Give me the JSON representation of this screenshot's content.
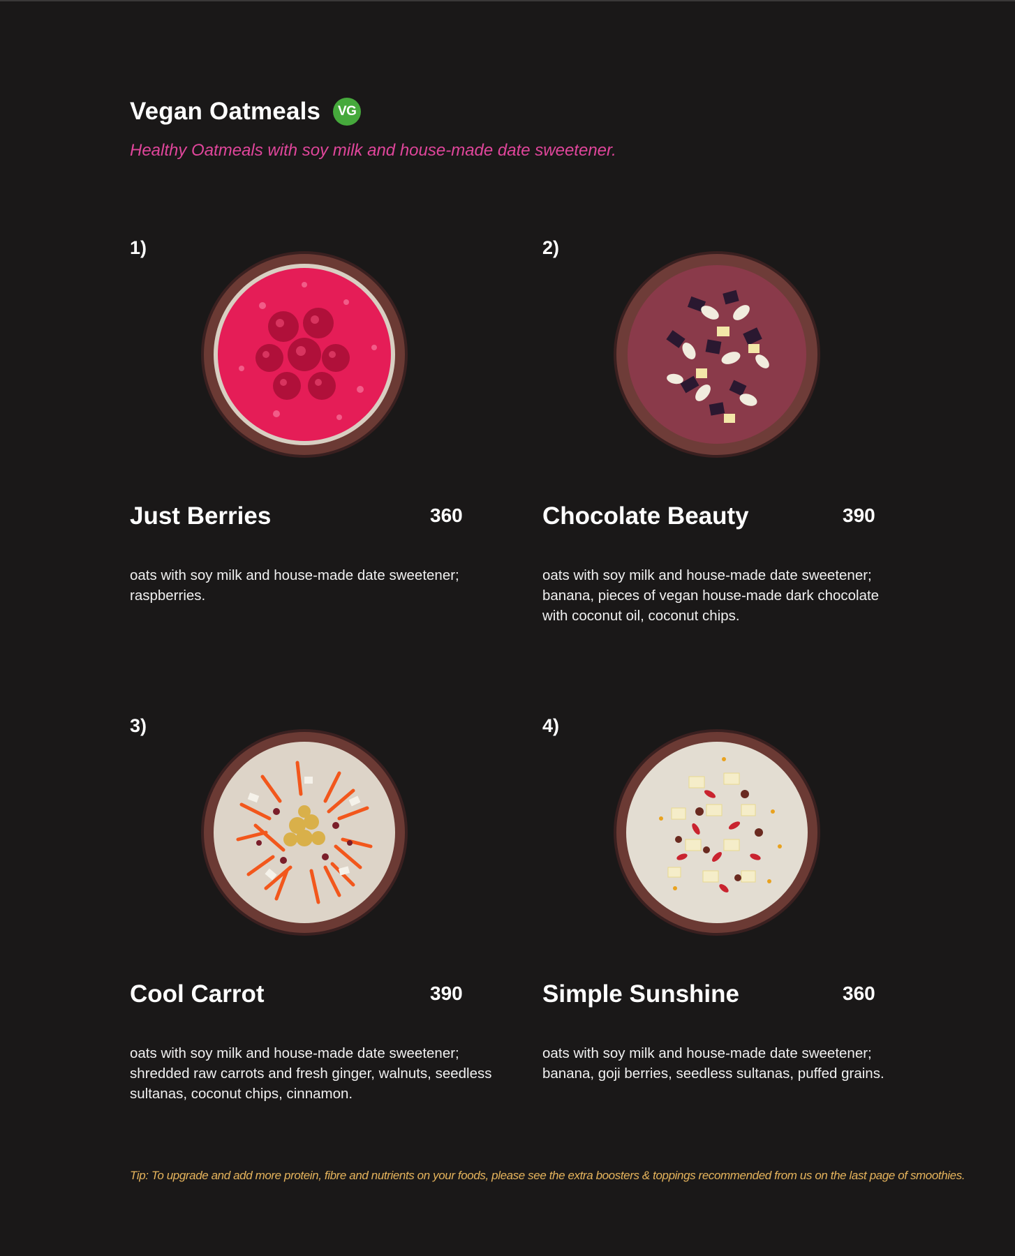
{
  "header": {
    "title": "Vegan Oatmeals",
    "badge": "VG",
    "subtitle": "Healthy Oatmeals with soy milk and house-made date sweetener."
  },
  "items": [
    {
      "number": "1)",
      "name": "Just Berries",
      "price": "360",
      "description": "oats with soy milk and house-made date sweetener; raspberries.",
      "image": "raspberry-oatmeal-bowl"
    },
    {
      "number": "2)",
      "name": "Chocolate Beauty",
      "price": "390",
      "description": "oats with soy milk and house-made date sweetener; banana, pieces of vegan house-made dark chocolate with coconut oil, coconut chips.",
      "image": "chocolate-oatmeal-bowl"
    },
    {
      "number": "3)",
      "name": "Cool Carrot",
      "price": "390",
      "description": "oats with soy milk and house-made date sweetener; shredded raw carrots and fresh ginger, walnuts, seedless sultanas, coconut chips, cinnamon.",
      "image": "carrot-oatmeal-bowl"
    },
    {
      "number": "4)",
      "name": "Simple Sunshine",
      "price": "360",
      "description": "oats with soy milk and house-made date sweetener; banana, goji berries, seedless sultanas, puffed grains.",
      "image": "banana-goji-oatmeal-bowl"
    }
  ],
  "tip": "Tip: To upgrade and add more protein, fibre and nutrients on your foods, please see the extra boosters & toppings recommended from us on the last page of smoothies.",
  "colors": {
    "background": "#1a1818",
    "subtitle": "#e0469b",
    "badge": "#46a93c",
    "tip": "#e6b45c"
  }
}
